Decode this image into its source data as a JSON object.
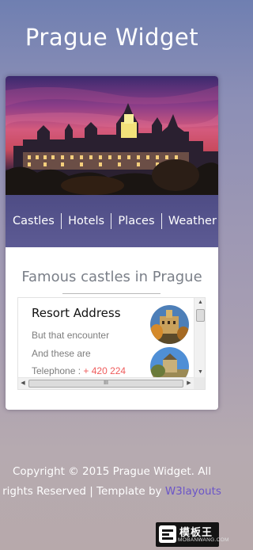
{
  "header": {
    "title": "Prague Widget"
  },
  "hero": {
    "image_icon": "prague-castle-night-photo"
  },
  "nav": {
    "items": [
      {
        "label": "Castles"
      },
      {
        "label": "Hotels"
      },
      {
        "label": "Places"
      },
      {
        "label": "Weather"
      }
    ]
  },
  "section": {
    "title": "Famous castles in Prague",
    "resort_title": "Resort Address",
    "line1": "But that encounter",
    "line2": "And these are",
    "phone_label": "Telephone : ",
    "phone_number": "+ 420 224"
  },
  "scrollbars": {
    "up_icon": "▲",
    "down_icon": "▼",
    "left_icon": "◀",
    "right_icon": "▶",
    "grip": "III"
  },
  "footer": {
    "copyright": "Copyright © 2015 Prague Widget. All rights Reserved | Template by ",
    "link": "W3layouts"
  },
  "watermark": {
    "main": "模板王",
    "sub": "MOBANWANG.COM"
  },
  "colors": {
    "nav_bg": "#4e4c85",
    "phone": "#ef5c5c",
    "footer_link": "#6a55c8"
  }
}
